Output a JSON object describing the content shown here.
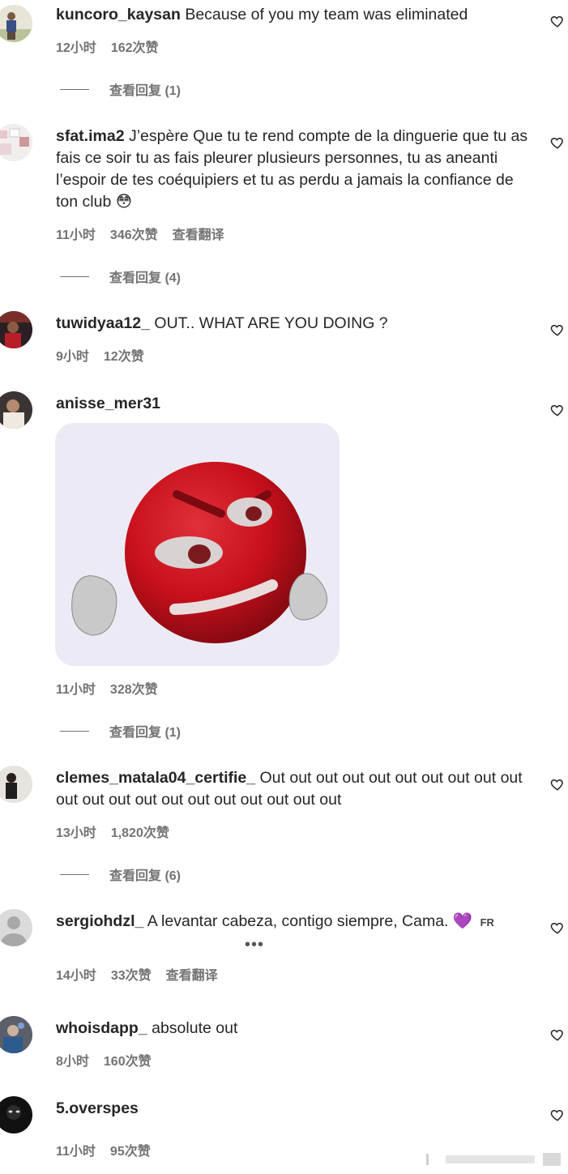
{
  "comments": [
    {
      "username": "kuncoro_kaysan",
      "text": "Because of you my team was eliminated",
      "time": "12小时",
      "likes": "162次赞",
      "replies": "查看回复 (1)"
    },
    {
      "username": "sfat.ima2",
      "text": "J’espère Que tu te rend compte de la dinguerie que tu as fais ce soir tu as fais pleurer plusieurs personnes, tu as aneanti l’espoir de tes coéquipiers et tu as perdu a jamais la confiance de ton club 😳",
      "time": "11小时",
      "likes": "346次赞",
      "translate": "查看翻译",
      "replies": "查看回复 (4)"
    },
    {
      "username": "tuwidyaa12_",
      "text": "OUT.. WHAT ARE YOU DOING ?",
      "time": "9小时",
      "likes": "12次赞"
    },
    {
      "username": "anisse_mer31",
      "text": "",
      "time": "11小时",
      "likes": "328次赞",
      "replies": "查看回复 (1)"
    },
    {
      "username": "clemes_matala04_certifie_",
      "text": "Out out out out out out out out out out out out out out out out out out out out out",
      "time": "13小时",
      "likes": "1,820次赞",
      "replies": "查看回复 (6)"
    },
    {
      "username": "sergiohdzl_",
      "text": "A levantar cabeza, contigo siempre, Cama. 💜",
      "flag": "FR",
      "more": "•••",
      "time": "14小时",
      "likes": "33次赞",
      "translate": "查看翻译"
    },
    {
      "username": "whoisdapp_",
      "text": "absolute out",
      "time": "8小时",
      "likes": "160次赞"
    },
    {
      "username": "5.overspes",
      "text": "",
      "time": "11小时",
      "likes": "95次赞"
    }
  ],
  "colors": {
    "text": "#262626",
    "meta": "#737373",
    "sticker_bg": "#ecebf5",
    "sticker_red": "#c8101c"
  }
}
